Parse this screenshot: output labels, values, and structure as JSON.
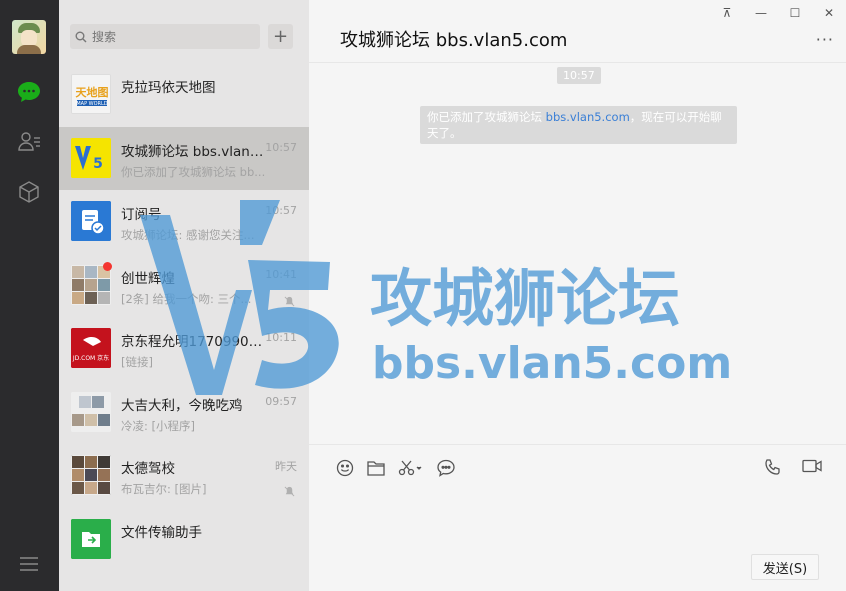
{
  "app": {
    "search_placeholder": "搜索",
    "add_label": "+"
  },
  "nav": {
    "items": [
      {
        "icon": "chat-icon",
        "active": true
      },
      {
        "icon": "contacts-icon",
        "active": false
      },
      {
        "icon": "box-icon",
        "active": false
      },
      {
        "icon": "menu-icon",
        "active": false
      }
    ]
  },
  "sessions": [
    {
      "name": "克拉玛依天地图",
      "time": "",
      "preview": ""
    },
    {
      "name": "攻城狮论坛 bbs.vlan5...",
      "time": "10:57",
      "preview": "你已添加了攻城狮论坛 bb..."
    },
    {
      "name": "订阅号",
      "time": "10:57",
      "preview": "攻城狮论坛: 感谢您关注..."
    },
    {
      "name": "创世辉煌",
      "time": "10:41",
      "preview": "[2条] 给我一个吻: 三个..."
    },
    {
      "name": "京东程允明17709908...",
      "time": "10:11",
      "preview": "[链接]"
    },
    {
      "name": "大吉大利，今晚吃鸡",
      "time": "09:57",
      "preview": "冷凌: [小程序]"
    },
    {
      "name": "太德驾校",
      "time": "昨天",
      "preview": "布瓦吉尔: [图片]"
    },
    {
      "name": "文件传输助手",
      "time": "",
      "preview": ""
    }
  ],
  "chat": {
    "title": "攻城狮论坛 bbs.vlan5.com",
    "more": "···",
    "timestamp": "10:57",
    "system_message_prefix": "你已添加了攻城狮论坛 ",
    "system_message_link": "bbs.vlan5.com",
    "system_message_suffix": "，现在可以开始聊天了。",
    "send_label": "发送(S)"
  },
  "window": {
    "pin": "⊼",
    "minimize": "—",
    "maximize": "☐",
    "close": "✕"
  },
  "watermark": {
    "title": "攻城狮论坛",
    "url": "bbs.vlan5.com",
    "logo_text": "V5"
  },
  "colors": {
    "accent_green": "#1aad19",
    "link_blue": "#3a7fd6",
    "badge_red": "#f43530",
    "watermark_blue": "#4f9ad6"
  }
}
